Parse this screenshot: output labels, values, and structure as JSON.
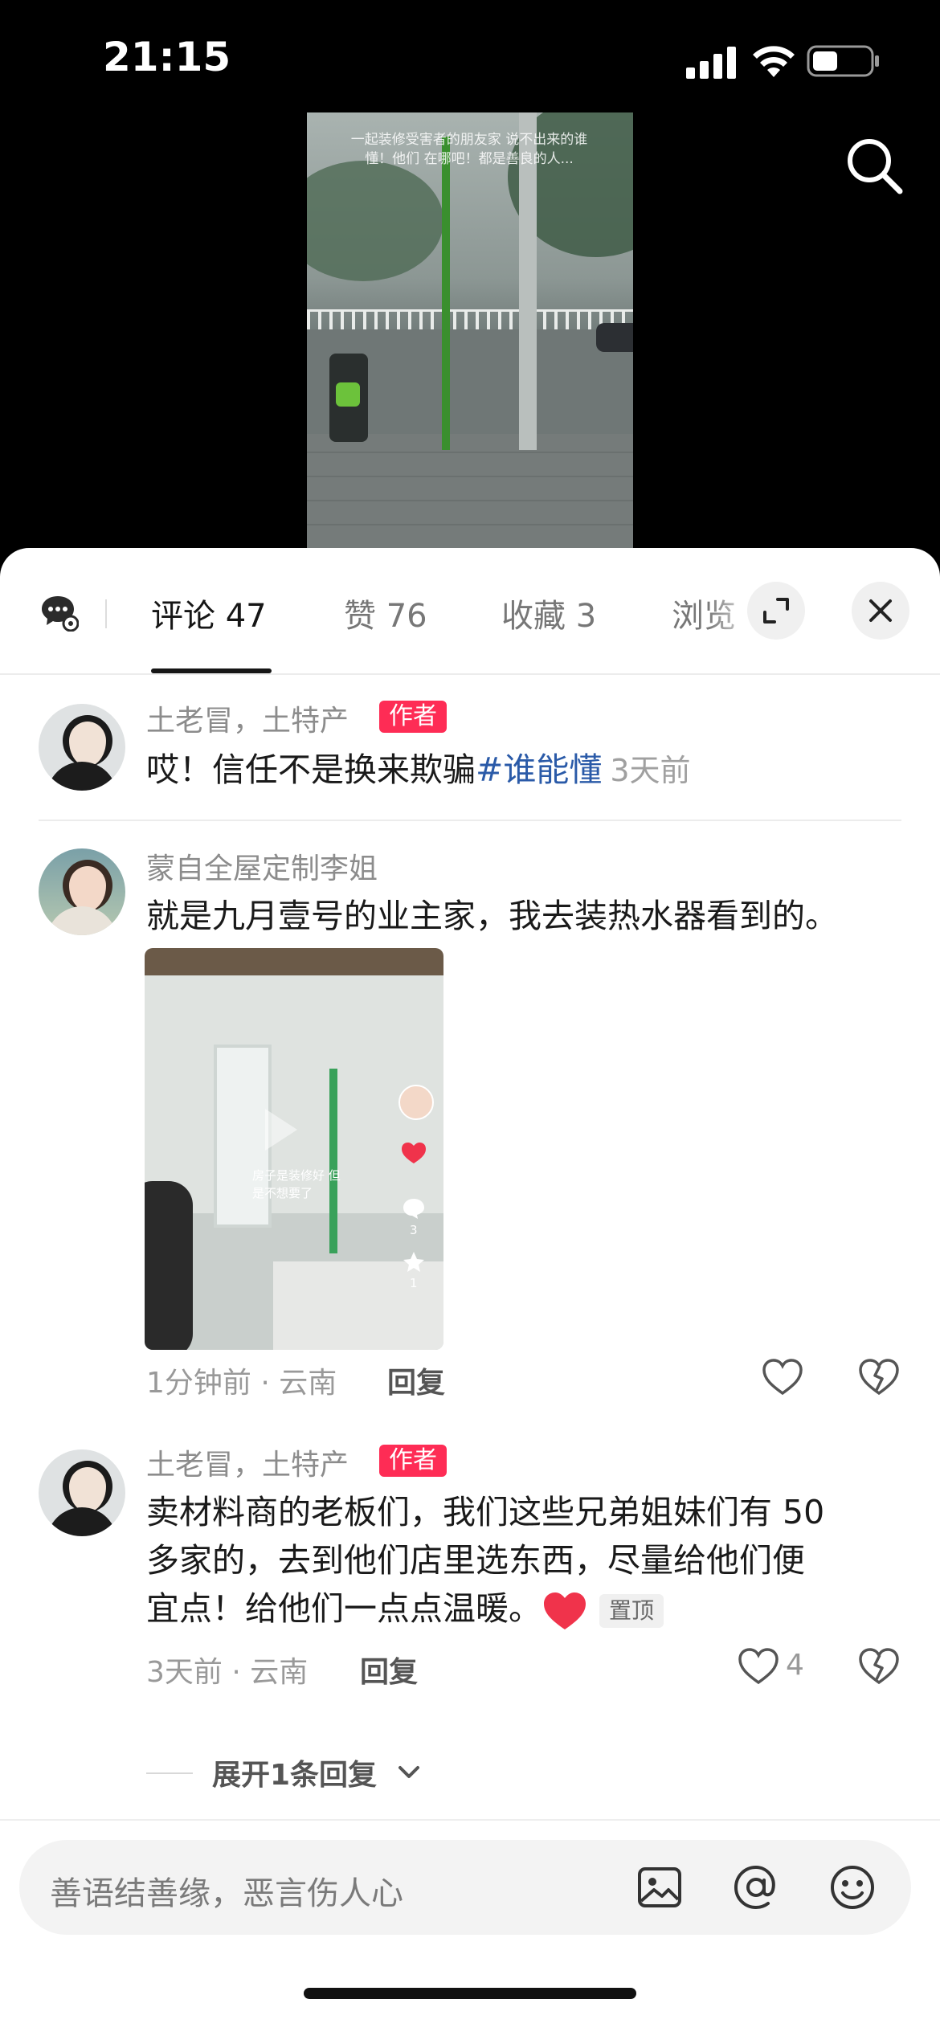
{
  "status": {
    "time": "21:15"
  },
  "video": {
    "caption": "一起装修受害者的朋友家 说不出来的谁懂！他们 在哪吧！都是善良的人..."
  },
  "tabs": [
    {
      "label": "评论",
      "count": "47",
      "active": true
    },
    {
      "label": "赞",
      "count": "76"
    },
    {
      "label": "收藏",
      "count": "3"
    },
    {
      "label": "浏览",
      "count": ""
    }
  ],
  "comments": [
    {
      "user": "土老冒，土特产",
      "badge": "作者",
      "text": "哎！信任不是换来欺骗",
      "hashtag": "#谁能懂",
      "time": "3天前"
    },
    {
      "user": "蒙自全屋定制李姐",
      "text": "就是九月壹号的业主家，我去装热水器看到的。",
      "image_caption": "房子是装修好 但是不想要了",
      "image_side_counts": [
        "3",
        "1"
      ],
      "time": "1分钟前 · 云南",
      "reply": "回复"
    },
    {
      "user": "土老冒，土特产",
      "badge": "作者",
      "text_lines": [
        "卖材料商的老板们，我们这些兄弟姐妹们有 50",
        "多家的，去到他们店里选东西，尽量给他们便",
        "宜点！给他们一点点温暖。"
      ],
      "pin": "置顶",
      "time": "3天前 · 云南",
      "reply": "回复",
      "likes": "4",
      "expand_replies": "展开1条回复"
    }
  ],
  "input": {
    "placeholder": "善语结善缘，恶言伤人心"
  },
  "colors": {
    "accent_red": "#fe2c55",
    "hashtag": "#2a5aa8"
  }
}
